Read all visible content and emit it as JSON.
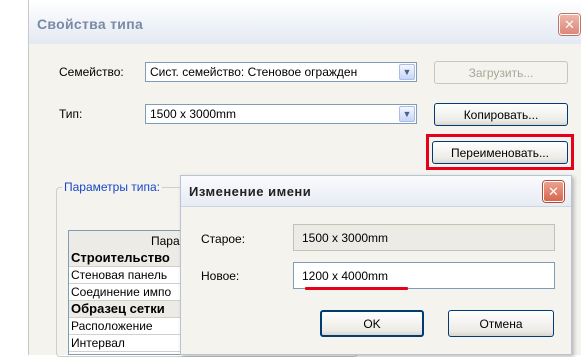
{
  "main_dialog": {
    "title": "Свойства типа",
    "family_label": "Семейство:",
    "family_value": "Сист. семейство: Стеновое огражден",
    "type_label": "Тип:",
    "type_value": "1500 x 3000mm",
    "load_button": "Загрузить...",
    "copy_button": "Копировать...",
    "rename_button": "Переименовать...",
    "params_caption": "Параметры типа:",
    "table": {
      "header": "Пара",
      "rows": [
        {
          "text": "Строительство",
          "group": true
        },
        {
          "text": "Стеновая панель",
          "group": false
        },
        {
          "text": "Соединение импо",
          "group": false
        },
        {
          "text": "Образец сетки",
          "group": true
        },
        {
          "text": "Расположение",
          "group": false
        },
        {
          "text": "Интервал",
          "group": false
        }
      ]
    }
  },
  "rename_dialog": {
    "title": "Изменение имени",
    "old_label": "Старое:",
    "old_value": "1500 x 3000mm",
    "new_label": "Новое:",
    "new_value": "1200 x 4000mm",
    "ok_button": "OK",
    "cancel_button": "Отмена"
  },
  "colors": {
    "highlight": "#e8001a",
    "dialog_bg": "#f4f3ee",
    "caption_blue": "#1a48c8"
  },
  "icons": {
    "close": "close-icon",
    "dropdown": "chevron-down-icon"
  }
}
